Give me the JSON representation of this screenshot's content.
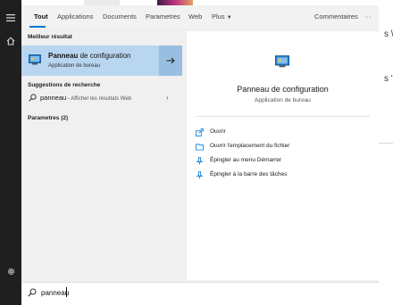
{
  "background": {
    "fragment_top": "s \\",
    "fragment_mid": "s '"
  },
  "tabs": [
    {
      "label": "Tout"
    },
    {
      "label": "Applications"
    },
    {
      "label": "Documents"
    },
    {
      "label": "Parametres"
    },
    {
      "label": "Web"
    },
    {
      "label": "Plus"
    }
  ],
  "header_right": {
    "feedback_label": "Commentaires",
    "more_label": "···"
  },
  "results": {
    "best_match_heading": "Meilleur résultat",
    "best_match": {
      "title_bold": "Panneau",
      "title_rest": " de configuration",
      "subtitle": "Application de bureau"
    },
    "suggestions_heading": "Suggestions de recherche",
    "suggestion": {
      "query": "panneau",
      "hint": " - Afficher les résultats Web"
    },
    "settings_heading": "Parametres (2)"
  },
  "preview": {
    "title": "Panneau de configuration",
    "subtitle": "Application de bureau",
    "actions": [
      {
        "label": "Ouvrir",
        "icon": "open-icon"
      },
      {
        "label": "Ouvrir l'emplacement du fichier",
        "icon": "file-location-icon"
      },
      {
        "label": "Épingler au menu Démarrer",
        "icon": "pin-start-icon"
      },
      {
        "label": "Épingler à la barre des tâches",
        "icon": "pin-taskbar-icon"
      }
    ]
  },
  "search": {
    "value": "panneau"
  },
  "colors": {
    "accent": "#0078d7",
    "selected_bg": "#b9d6f0",
    "rail_bg": "#1f1f1f"
  }
}
